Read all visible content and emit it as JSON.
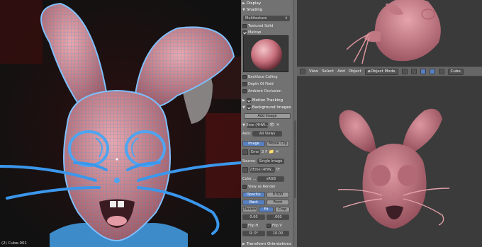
{
  "left_viewport": {
    "object_info": "(2) Cube.001"
  },
  "properties": {
    "display_label": "Display",
    "shading_label": "Shading",
    "shading_mode": "Multitexture",
    "textured_solid_label": "Textured Solid",
    "matcap_label": "Matcap",
    "backface_label": "Backface Culling",
    "dof_label": "Depth Of Field",
    "ao_label": "Ambient Occlusion",
    "motion_tracking_label": "Motion Tracking",
    "bg_images_label": "Background Images",
    "add_image_label": "Add Image",
    "image_name": "Eme (4HW...",
    "axis_label": "Axis:",
    "axis_value": "All Views",
    "image_tab": "Image",
    "movie_clip_tab": "Movie Clip",
    "img_block_name": "Eme",
    "img_users": "3",
    "img_fake": "F",
    "source_label": "Source:",
    "source_value": "Single Image",
    "filepath": "//Eme (4HW...",
    "color_label": "Color ...",
    "color_value": "sRGB",
    "view_as_render_label": "View as Render",
    "opacity_label": "Opacity:",
    "opacity_value": "0.500",
    "back_label": "Back",
    "front_label": "Front",
    "stretch_label": "Stretch",
    "fit_label": "Fit",
    "crop_label": "Crop",
    "x_value": "0.00",
    "y_value": ".000",
    "flip_h_label": "Flip H",
    "flip_v_label": "Flip V",
    "rot_value": "R: 0°",
    "size_value": "10.00",
    "transform_orientations_label": "Transform Orientations"
  },
  "header": {
    "view_menu": "View",
    "select_menu": "Select",
    "add_menu": "Add",
    "object_menu": "Object",
    "mode_value": "Object Mode",
    "object_name": "Cube"
  },
  "colors": {
    "rabbit_pink": "#d28a93",
    "wireframe_blue": "#5aa8f0",
    "accent_blue": "#5680c2",
    "panel_gray": "#727272"
  }
}
